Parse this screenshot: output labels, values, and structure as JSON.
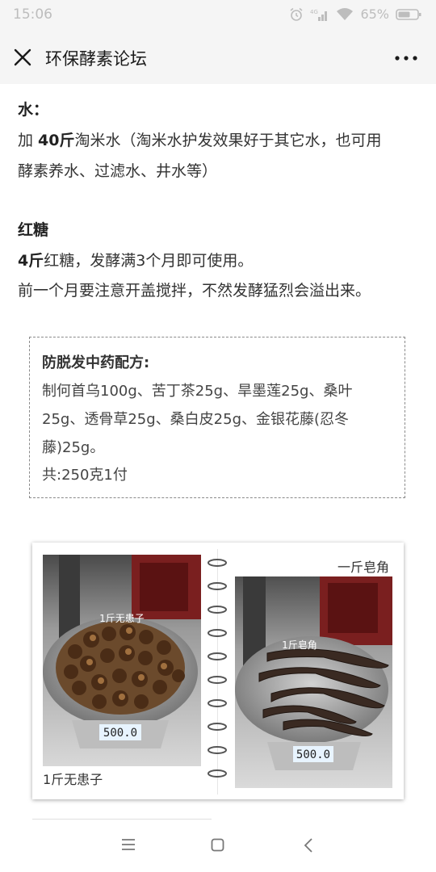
{
  "status_bar": {
    "time": "15:06",
    "network": "4G",
    "battery": "65%",
    "icons": [
      "alarm-icon",
      "signal-icon",
      "wifi-icon",
      "battery-icon"
    ]
  },
  "title_bar": {
    "title": "环保酵素论坛",
    "icons": [
      "close-icon",
      "more-icon"
    ]
  },
  "article": {
    "water": {
      "heading": "水：",
      "line1_prefix": "加 ",
      "line1_amount": "40斤",
      "line1_rest": "淘米水（淘米水护发效果好于其它水，也可用",
      "line2": "酵素养水、过滤水、井水等）"
    },
    "sugar": {
      "heading": "红糖",
      "line1_amount": "4斤",
      "line1_rest": "红糖，发酵满3个月即可使用。",
      "line2": "前一个月要注意开盖搅拌，不然发酵猛烈会溢出来。"
    },
    "recipe": {
      "title": "防脱发中药配方:",
      "line1": "制何首乌100g、苦丁茶25g、旱墨莲25g、桑叶",
      "line2": "25g、透骨草25g、桑白皮25g、金银花藤(忍冬",
      "line3": "藤)25g。",
      "line4": "共:250克1付"
    },
    "photo_card": {
      "left_caption": "1斤无患子",
      "left_photo_label": "1斤无患子",
      "left_scale_reading": "500.0",
      "right_caption": "一斤皂角",
      "right_photo_label": "1斤皂角",
      "right_scale_reading": "500.0"
    }
  },
  "nav_bar": {
    "icons": [
      "menu-icon",
      "home-icon",
      "back-icon"
    ]
  },
  "colors": {
    "status_bg": "#f5f5f5",
    "text": "#333333",
    "muted": "#bdbdbd"
  }
}
